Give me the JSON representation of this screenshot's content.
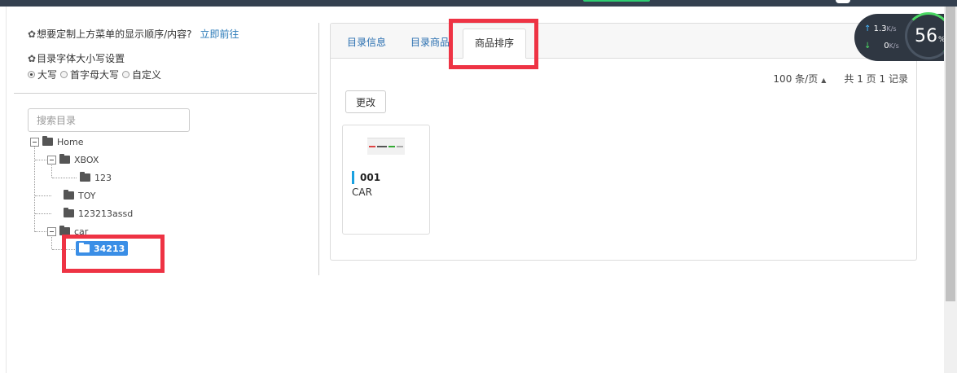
{
  "left": {
    "hint_text": "想要定制上方菜单的显示顺序/内容?",
    "hint_link": "立即前往",
    "font_setting_label": "目录字体大小写设置",
    "radio_options": [
      {
        "label": "大写",
        "checked": true
      },
      {
        "label": "首字母大写",
        "checked": false
      },
      {
        "label": "自定义",
        "checked": false
      }
    ],
    "search_placeholder": "搜索目录",
    "tree": {
      "home": "Home",
      "xbox": "XBOX",
      "n123": "123",
      "toy": "TOY",
      "n123213assd": "123213assd",
      "car": "car",
      "n34213": "34213"
    }
  },
  "panel": {
    "tabs": [
      "目录信息",
      "目录商品",
      "商品排序"
    ],
    "active_tab": "商品排序",
    "pager": {
      "per_page": "100",
      "per_page_unit": "条/页",
      "total_prefix": "共",
      "pages": "1",
      "pages_unit": "页",
      "records": "1",
      "records_unit": "记录"
    },
    "change_button": "更改",
    "product": {
      "code": "001",
      "name": "CAR"
    }
  },
  "speed_widget": {
    "upload": "1.3",
    "upload_unit": "K/s",
    "download": "0",
    "download_unit": "K/s",
    "percent": "56",
    "percent_unit": "%"
  },
  "colors": {
    "accent_blue": "#3a8ee6",
    "link_blue": "#2a7ab8",
    "highlight_red": "#ee3344",
    "topbar": "#34404f"
  }
}
